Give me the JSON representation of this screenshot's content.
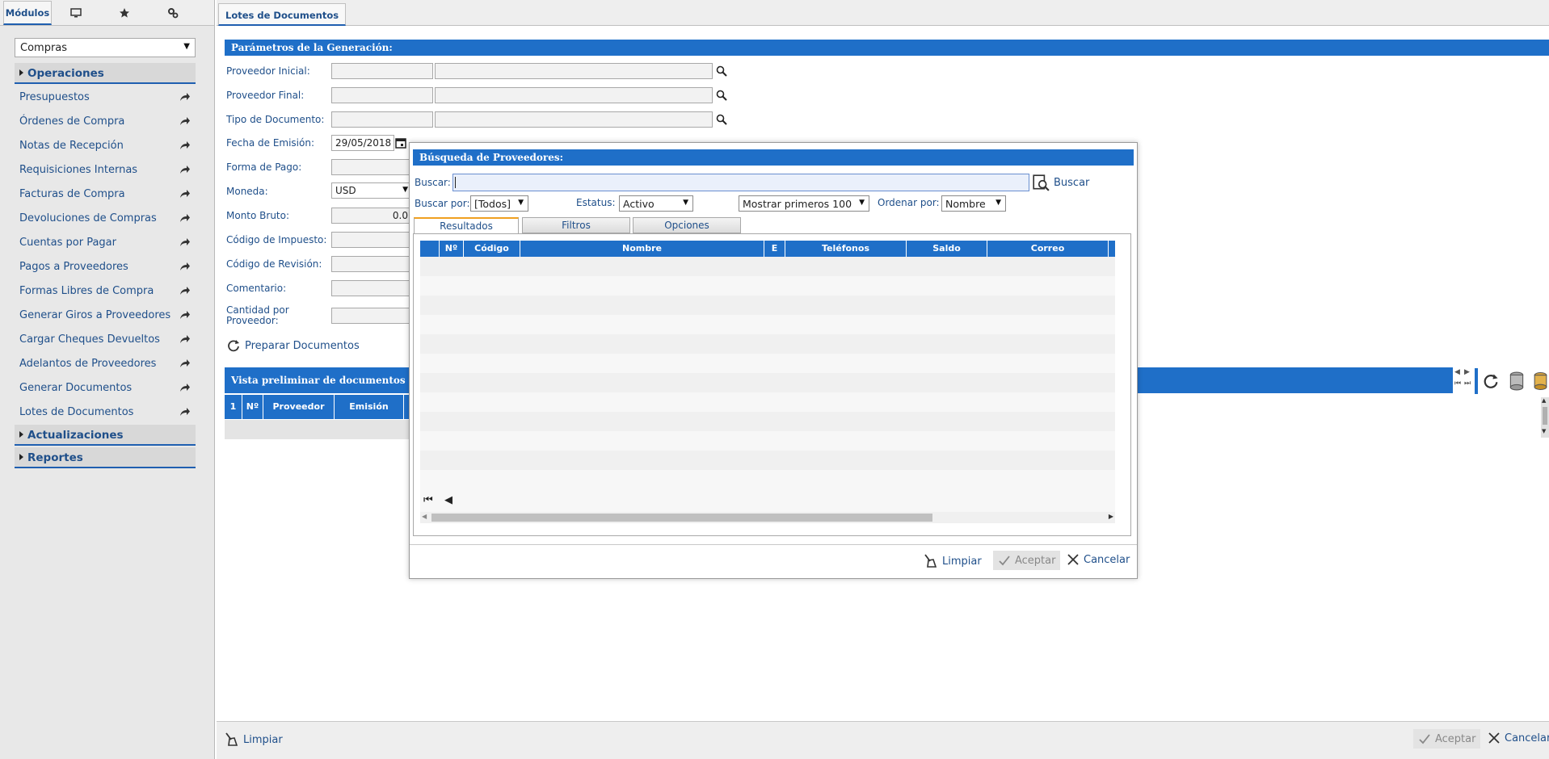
{
  "left_panel": {
    "tabs": [
      {
        "label": "Módulos",
        "icon": "modules-tab"
      },
      {
        "label": "",
        "icon": "monitor-icon"
      },
      {
        "label": "",
        "icon": "star-icon"
      },
      {
        "label": "",
        "icon": "settings-icon"
      }
    ],
    "module_select": "Compras",
    "sections": {
      "operaciones": "Operaciones",
      "actualizaciones": "Actualizaciones",
      "reportes": "Reportes"
    },
    "menu_items": [
      "Presupuestos",
      "Órdenes de Compra",
      "Notas de Recepción",
      "Requisiciones Internas",
      "Facturas de Compra",
      "Devoluciones de Compras",
      "Cuentas por Pagar",
      "Pagos a Proveedores",
      "Formas Libres de Compra",
      "Generar Giros a Proveedores",
      "Cargar Cheques Devueltos",
      "Adelantos de Proveedores",
      "Generar Documentos",
      "Lotes de Documentos"
    ]
  },
  "main": {
    "tab_label": "Lotes de Documentos",
    "params_title": "Parámetros de la Generación:",
    "fields": {
      "proveedor_inicial": "Proveedor Inicial:",
      "proveedor_final": "Proveedor Final:",
      "tipo_documento": "Tipo de Documento:",
      "fecha_emision": "Fecha de Emisión:",
      "forma_pago": "Forma de Pago:",
      "moneda": "Moneda:",
      "monto_bruto": "Monto Bruto:",
      "codigo_impuesto": "Código de Impuesto:",
      "codigo_revision": "Código de Revisión:",
      "comentario": "Comentario:",
      "cantidad_proveedor": "Cantidad por Proveedor:"
    },
    "values": {
      "fecha_emision": "29/05/2018",
      "moneda": "USD",
      "monto_bruto": "0.0"
    },
    "prepare_label": "Preparar Documentos",
    "preview_title": "Vista preliminar de documentos a",
    "preview_columns": [
      "1",
      "Nº",
      "Proveedor",
      "Emisión"
    ],
    "bottom_actions": {
      "limpiar": "Limpiar",
      "aceptar": "Aceptar",
      "cancelar": "Cancelar"
    }
  },
  "dialog": {
    "title": "Búsqueda de Proveedores:",
    "buscar_label": "Buscar:",
    "buscar_value": "",
    "buscar_button": "Buscar",
    "buscar_por_label": "Buscar por:",
    "buscar_por_value": "[Todos]",
    "estatus_label": "Estatus:",
    "estatus_value": "Activo",
    "mostrar_value": "Mostrar primeros 100",
    "ordenar_label": "Ordenar por:",
    "ordenar_value": "Nombre",
    "tabs": [
      "Resultados",
      "Filtros",
      "Opciones"
    ],
    "columns": [
      "Nº",
      "Código",
      "Nombre",
      "E",
      "Teléfonos",
      "Saldo",
      "Correo"
    ],
    "actions": {
      "limpiar": "Limpiar",
      "aceptar": "Aceptar",
      "cancelar": "Cancelar"
    }
  },
  "colors": {
    "accent": "#1f6fc8",
    "link_text": "#1f4f8a",
    "active_tab_border": "#f0a020"
  }
}
